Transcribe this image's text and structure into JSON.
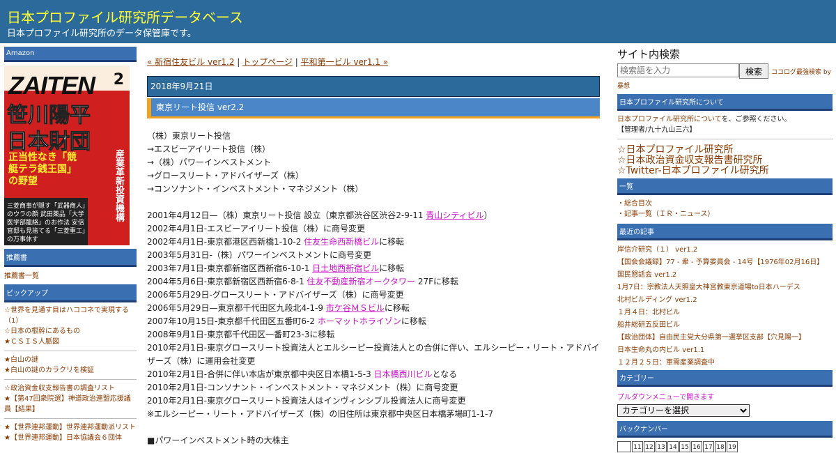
{
  "site": {
    "title": "日本プロファイル研究所データベース",
    "description": "日本プロファイル研究所のデータ保管庫です。"
  },
  "left": {
    "amazon_head": "Amazon",
    "ad": {
      "magazine": "ZAITEN",
      "issue": "2",
      "headline1": "笹川陽平",
      "headline2": "日本財団",
      "sub": "正当性なき「競艇テラ銭王国」の野望",
      "vertical": "産業革新投資機構",
      "box": "三菱商事が隠す「武器商人」のウラの顔 武田薬品「大学医学部籠絡」のお作法 安倍官邸も見捨てる「三菱重工」の万事休す"
    },
    "recommend_head": "推薦書",
    "recommend_link": "推薦書一覧",
    "pickup_head": "ピックアップ",
    "pickup_group1": [
      "☆世界を見通す目はハココネで実現する（1）",
      "☆日本の根幹にあるもの",
      "★ＣＳＩＳ人脈図"
    ],
    "pickup_group2": [
      "★白山の謎",
      "★白山の謎のカラクリを検証"
    ],
    "pickup_group3": [
      "☆政治資金収支報告書の調査リスト",
      "★【第47回衆院選】神道政治連盟応援議員【結果】"
    ],
    "pickup_group4": [
      "★【世界連邦運動】世界連邦運動派リスト",
      "★【世界連邦運動】日本協議会６団体"
    ]
  },
  "main": {
    "nav_prev": "« 新宿住友ビル ver1.2",
    "nav_sep1": " | ",
    "nav_top": "トップページ",
    "nav_sep2": " | ",
    "nav_next": "平和第一ビル ver1.1 »",
    "date": "2018年9月21日",
    "title": "東京リート投信 ver2.2",
    "names": [
      "（株）東京リート投信",
      "→エスビーアイリート投信（株）",
      "→（株）パワーインベストメント",
      "→グロースリート・アドバイザーズ（株）",
      "→コンソナント・インベストメント・マネジメント（株）"
    ],
    "h1": {
      "pre": "2001年4月12日—（株）東京リート投信 設立（東京都渋谷区渋谷2-9-11 ",
      "link": "青山シティビル",
      "post": "）"
    },
    "h2": "2002年4月1日-エスビーアイリート投信（株）に商号変更",
    "h3": {
      "pre": "2002年4月1日-東京都港区西新橋1-10-2 ",
      "link": "住友生命西新橋ビル",
      "post": "に移転"
    },
    "h4": "2003年5月31日-（株）パワーインベストメントに商号変更",
    "h5": {
      "pre": "2003年7月1日-東京都新宿区西新宿6-10-1 ",
      "link": "日土地西新宿ビル",
      "post": "に移転"
    },
    "h6": {
      "pre": "2004年5月6日-東京都新宿区西新宿6-8-1 ",
      "link": "住友不動産新宿オークタワー",
      "post": " 27Fに移転"
    },
    "h7": "2006年5月29日-グロースリート・アドバイザーズ（株）に商号変更",
    "h8": {
      "pre": "2006年5月29日—東京都千代田区九段北4-1-9 ",
      "link": "市ケ谷ＭＳビル",
      "post": "に移転"
    },
    "h9": {
      "pre": "2007年10月15日-東京都千代田区五番町6-2 ",
      "link": "ホーマットホライゾン",
      "post": "に移転"
    },
    "h10": "2008年9月1日-東京都千代田区一番町23-3に移転",
    "h11": "2010年2月1日-東京グロースリート投資法人とエルシーピー投資法人との合併に伴い、エルシーピー・リート・アドバイザーズ（株）に運用会社変更",
    "h12": {
      "pre": "2010年2月1日-合併に伴い本店が東京都中央区日本橋1-5-3 ",
      "link": "日本橋西川ビル",
      "post": "となる"
    },
    "h13": "2010年2月1日-コンソナント・インベストメント・マネジメント（株）に商号変更",
    "h14": "2010年2月1日-東京グロースリート投資法人はインヴィンシブル投資法人に商号変更",
    "h15": "※エルシーピー・リート・アドバイザーズ（株）の旧住所は東京都中央区日本橋茅場町1-1-7",
    "section": "■パワーインベストメント時の大株主"
  },
  "right": {
    "search_title": "サイト内検索",
    "search_placeholder": "検索語を入力",
    "search_button": "検索",
    "search_note": "ココログ最強検索 by",
    "search_note2": "暴想",
    "about_head": "日本プロファイル研究所について",
    "about_link": "日本プロファイル研究所について",
    "about_text": "を、ご参照ください。",
    "admin": "【管理者/九十九山三六】",
    "links": [
      "☆日本プロファイル研究所",
      "☆日本政治資金収支報告書研究所",
      "☆Twitter-日本プロファイル研究所"
    ],
    "list_head": "一覧",
    "list_items": [
      "・総合目次",
      "・記事一覧（ＩＲ・ニュース）"
    ],
    "recent_head": "最近の記事",
    "recent": [
      "岸信介研究（１） ver1.2",
      "【国会会議録】77 - 衆 - 予算委員会 - 14号【1976年02月16日】",
      "国民懇話会 ver1.2",
      "1月7日：宗教法人天照皇大神宮教東京道場to日本ハーデス",
      "北村ビルディング ver1.2",
      "１月４日：北村ビル",
      "船井総研五反田ビル",
      "【政治団体】自由民主党大分県第一選挙区支部【穴見陽一】",
      "日本生命丸の内ビル ver1.1",
      "１２月２５日：軍需産業調査中"
    ],
    "category_head": "カテゴリー",
    "category_note": "プルダウンメニューで開きます",
    "category_select": "カテゴリーを選択",
    "backnum_head": "バックナンバー",
    "backnum": [
      "11",
      "12",
      "13",
      "14",
      "15",
      "16",
      "17",
      "18",
      "19"
    ]
  }
}
